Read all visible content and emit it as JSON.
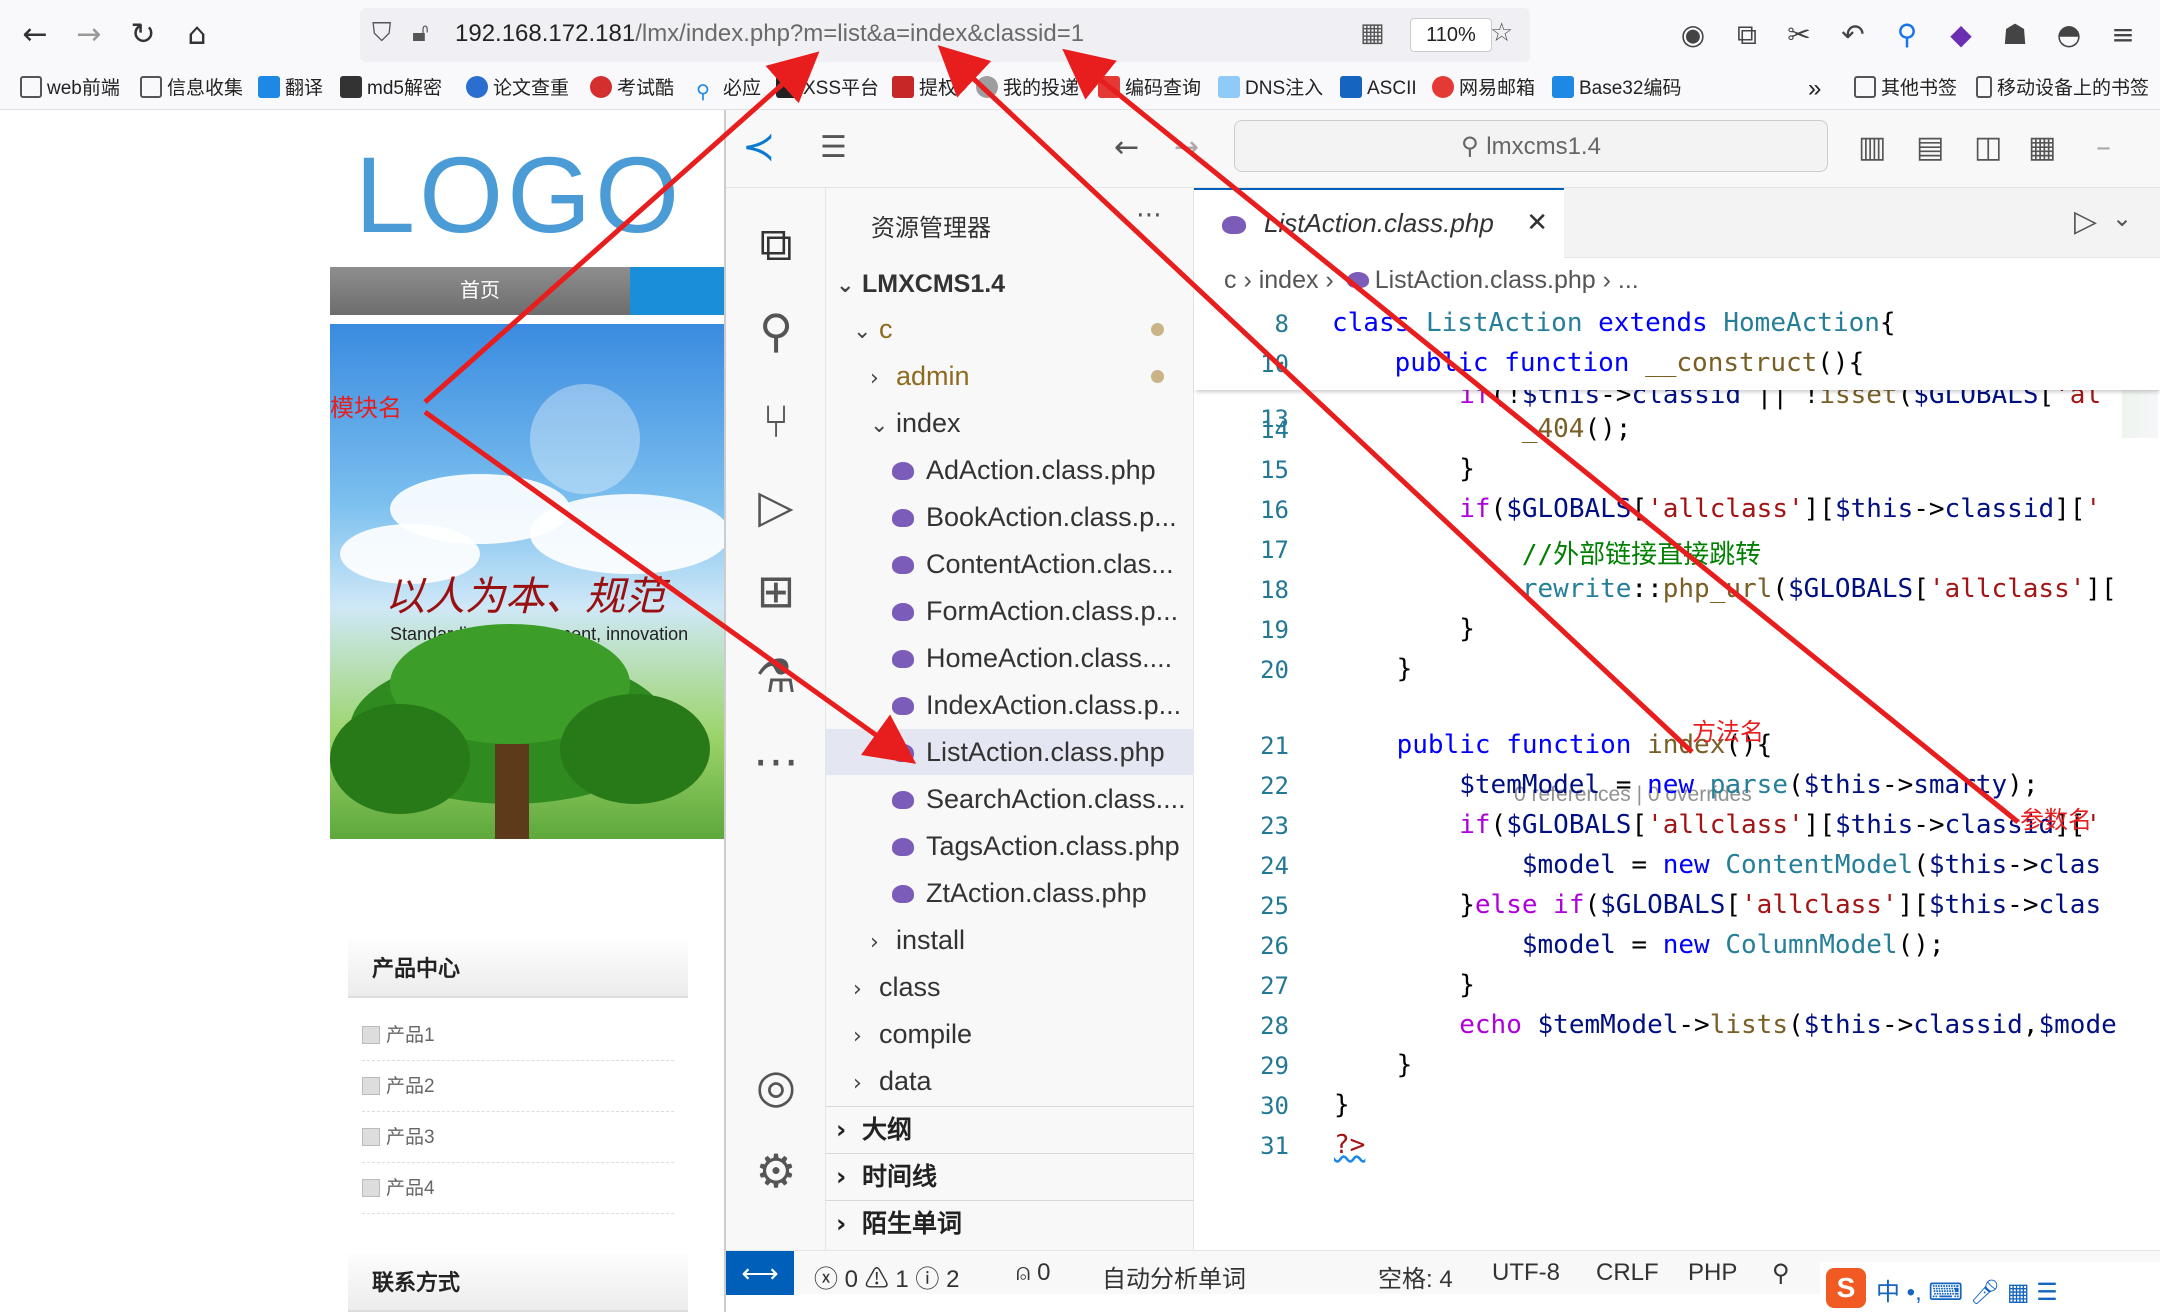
{
  "browser": {
    "url_host": "192.168.172.181",
    "url_rest": "/lmx/index.php?m=list&a=index&classid=1",
    "zoom": "110%",
    "bookmarks": [
      "web前端",
      "信息收集",
      "翻译",
      "md5解密",
      "论文查重",
      "考试酷",
      "必应",
      "XSS平台",
      "提权",
      "我的投递",
      "编码查询",
      "DNS注入",
      "ASCII",
      "网易邮箱",
      "Base32编码"
    ],
    "other_bookmarks": "其他书签",
    "mobile_bookmarks": "移动设备上的书签"
  },
  "site": {
    "logo": "LOGO",
    "nav_home": "首页",
    "slogan_cn": "以人为本、规范",
    "slogan_en": "Standardize management, innovation",
    "product_box_title": "产品中心",
    "products": [
      "产品1",
      "产品2",
      "产品3",
      "产品4"
    ],
    "contact_title": "联系方式"
  },
  "vscode": {
    "search": "lmxcms1.4",
    "explorer_title": "资源管理器",
    "project": "LMXCMS1.4",
    "tree": {
      "c": "c",
      "admin": "admin",
      "index": "index",
      "files": [
        "AdAction.class.php",
        "BookAction.class.p...",
        "ContentAction.clas...",
        "FormAction.class.p...",
        "HomeAction.class....",
        "IndexAction.class.p...",
        "ListAction.class.php",
        "SearchAction.class....",
        "TagsAction.class.php",
        "ZtAction.class.php"
      ],
      "install": "install",
      "class": "class",
      "compile": "compile",
      "data": "data"
    },
    "sections": [
      "大纲",
      "时间线",
      "陌生单词"
    ],
    "tab_title": "ListAction.class.php",
    "breadcrumb": {
      "a": "c",
      "b": "index",
      "c": "ListAction.class.php",
      "d": "..."
    },
    "codelens": "0 references | 0 overrides",
    "status": {
      "errors": "0",
      "warnings": "1",
      "infos": "2",
      "ports": "0",
      "spell": "自动分析单词",
      "spaces": "空格: 4",
      "encoding": "UTF-8",
      "eol": "CRLF",
      "lang": "PHP"
    }
  },
  "annotations": {
    "module": "模块名",
    "method": "方法名",
    "param": "参数名"
  }
}
